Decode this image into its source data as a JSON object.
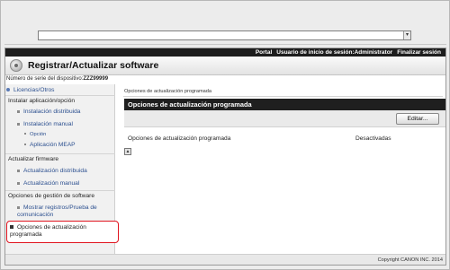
{
  "address_bar": {
    "value": "",
    "dropdown_icon": "chevron-down-icon"
  },
  "topbar": {
    "portal": "Portal",
    "login_user": "Usuario de inicio de sesión:Administrator",
    "logout": "Finalizar sesión"
  },
  "header": {
    "icon": "settings-disc-icon",
    "title": "Registrar/Actualizar software"
  },
  "serial": {
    "label": "Número de serie del dispositivo:",
    "value": "ZZZ99999"
  },
  "sidebar": {
    "licenses": "Licencias/Otros",
    "install_group": "Instalar aplicación/opción",
    "distributed_install": "Instalación distribuida",
    "manual_install": "Instalación manual",
    "option": "Opción",
    "meap": "Aplicación MEAP",
    "firmware_group": "Actualizar firmware",
    "distributed_update": "Actualización distribuida",
    "manual_update": "Actualización manual",
    "mgmt_group": "Opciones de gestión de software",
    "show_logs": "Mostrar registros/Prueba de comunicación",
    "scheduled_options": "Opciones de actualización programada"
  },
  "main": {
    "breadcrumb": "Opciones de actualización programada",
    "panel_title": "Opciones de actualización programada",
    "edit_button": "Editar...",
    "setting_label": "Opciones de actualización programada",
    "setting_value": "Desactivadas",
    "top_icon": "arrow-up-to-top-icon"
  },
  "footer": {
    "copyright": "Copyright CANON INC. 2014"
  }
}
